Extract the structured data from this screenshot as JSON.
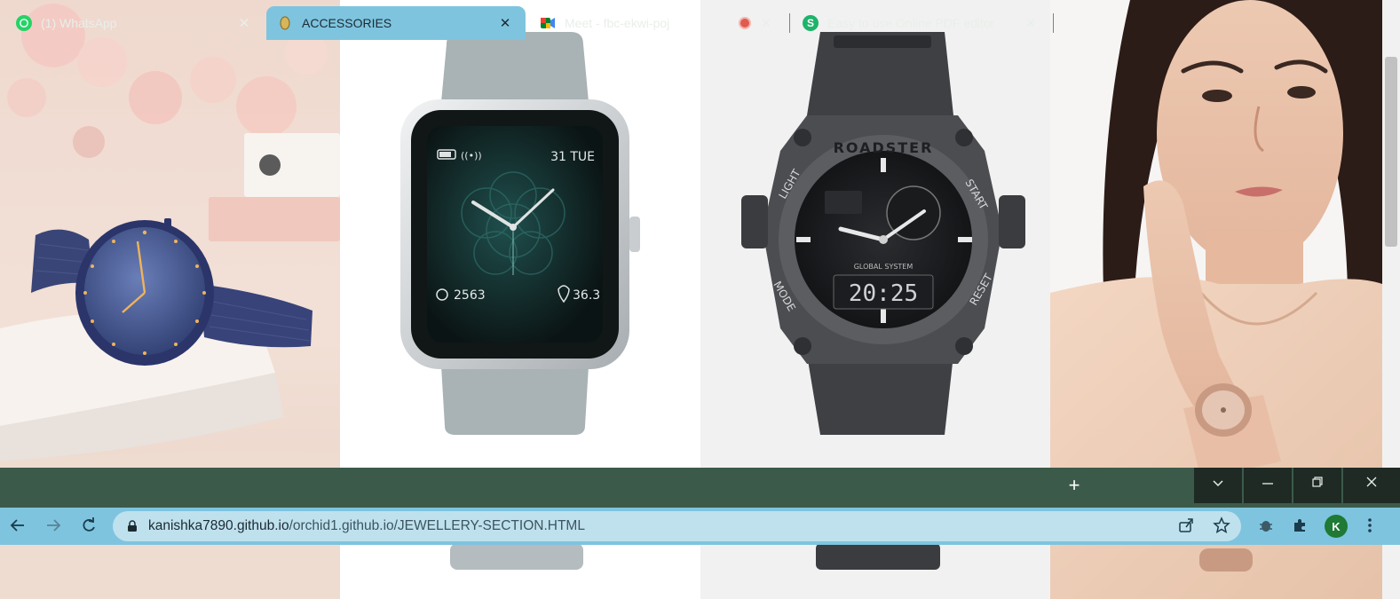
{
  "products": {
    "watch1": {
      "icon": "mesh-strap-watch-image"
    },
    "watch2": {
      "time_date": "31 TUE",
      "steps": "2563",
      "distance": "36.3",
      "icon": "smartwatch-image"
    },
    "watch3": {
      "brand_text": "ROADSTER",
      "label_light": "LIGHT",
      "label_start": "START",
      "label_mode": "MODE",
      "label_reset": "RESET",
      "digital_time": "20:25",
      "system_text": "GLOBAL SYSTEM",
      "icon": "sport-watch-image"
    },
    "watch4": {
      "icon": "model-wearing-watch-image"
    }
  },
  "tabs": [
    {
      "title": "(1) WhatsApp",
      "icon": "whatsapp-icon",
      "active": false
    },
    {
      "title": "ACCESSORIES",
      "icon": "page-favicon",
      "active": true
    },
    {
      "title": "Meet - fbc-ekwi-poj",
      "icon": "meet-icon",
      "active": false
    },
    {
      "title": "Easy to use Online PDF editor",
      "icon": "sejda-icon",
      "active": false
    }
  ],
  "address_bar": {
    "host": "kanishka7890.github.io",
    "path": "/orchid1.github.io/JEWELLERY-SECTION.HTML"
  },
  "profile": {
    "initial": "K"
  },
  "colors": {
    "tabstrip": "#3c5a4a",
    "toolbar": "#7ec4df",
    "omnibox": "#bfe1ee",
    "active_tab": "#7ec4df"
  }
}
